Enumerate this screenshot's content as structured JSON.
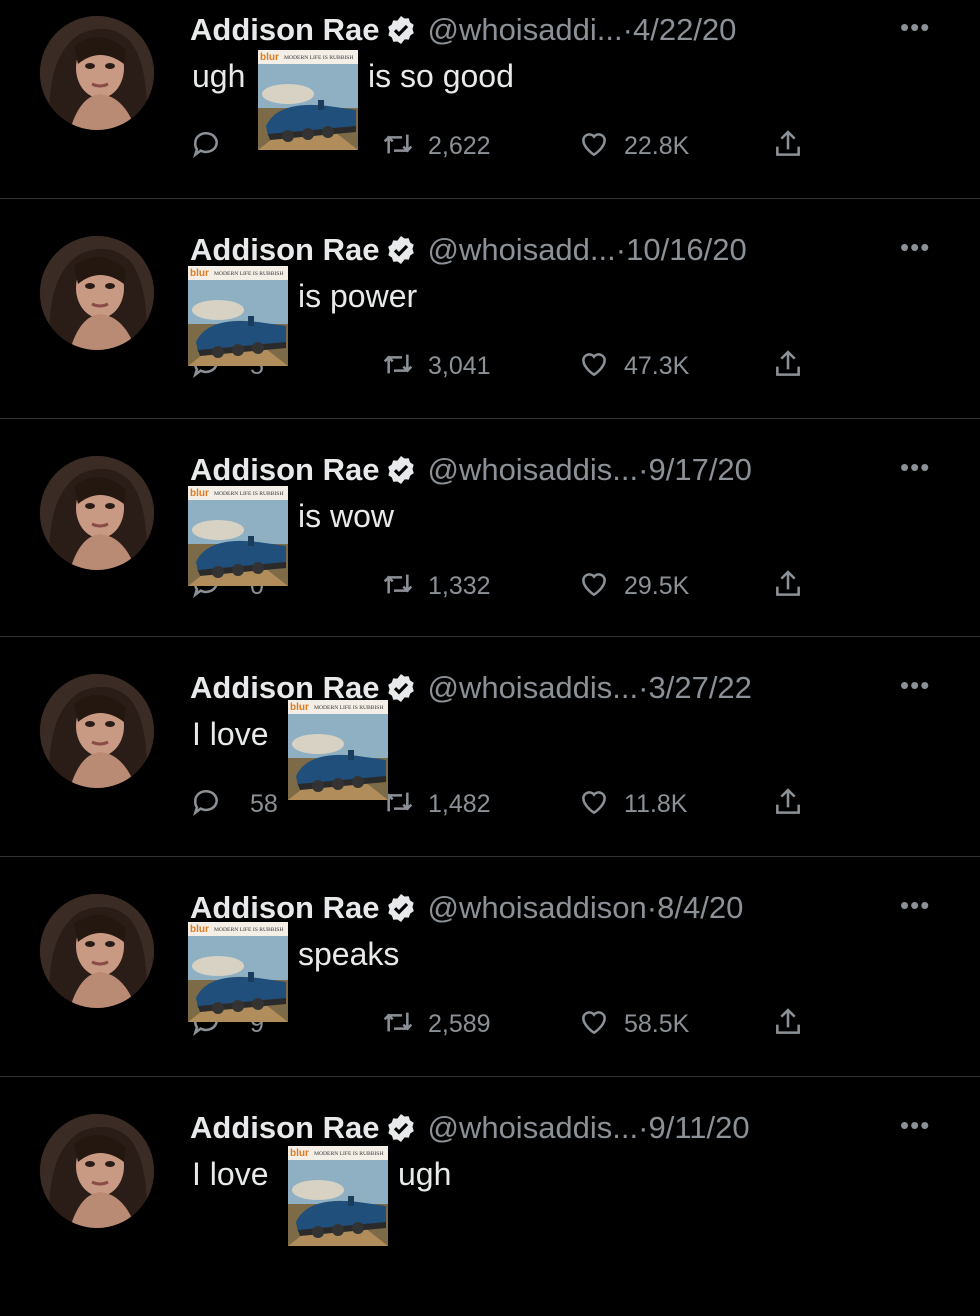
{
  "tweets": [
    {
      "name": "Addison Rae",
      "handle": "@whoisaddi...",
      "dot": "·",
      "date": "4/22/20",
      "before": "ugh",
      "after": "is so good",
      "reply": "",
      "retweets": "2,622",
      "likes": "22.8K",
      "variant": "inline"
    },
    {
      "name": "Addison Rae",
      "handle": "@whoisadd...",
      "dot": "·",
      "date": "10/16/20",
      "before": "",
      "after": "is power",
      "reply": "5",
      "retweets": "3,041",
      "likes": "47.3K",
      "variant": "left"
    },
    {
      "name": "Addison Rae",
      "handle": "@whoisaddis...",
      "dot": "·",
      "date": "9/17/20",
      "before": "",
      "after": "is wow",
      "reply": "0",
      "retweets": "1,332",
      "likes": "29.5K",
      "variant": "left"
    },
    {
      "name": "Addison Rae",
      "handle": "@whoisaddis...",
      "dot": "·",
      "date": "3/27/22",
      "before": "I love",
      "after": "",
      "reply": "58",
      "retweets": "1,482",
      "likes": "11.8K",
      "variant": "inline"
    },
    {
      "name": "Addison Rae",
      "handle": "@whoisaddison",
      "dot": "·",
      "date": "8/4/20",
      "before": "",
      "after": "speaks",
      "reply": "9",
      "retweets": "2,589",
      "likes": "58.5K",
      "variant": "left"
    },
    {
      "name": "Addison Rae",
      "handle": "@whoisaddis...",
      "dot": "·",
      "date": "9/11/20",
      "before": "I love",
      "after": "ugh",
      "reply": "",
      "retweets": "",
      "likes": "",
      "variant": "inline"
    }
  ],
  "album": {
    "band": "blur",
    "title": "MODERN LIFE IS RUBBISH"
  },
  "more_label": "•••",
  "icons": {
    "reply": "reply-icon",
    "retweet": "retweet-icon",
    "like": "heart-icon",
    "share": "share-icon",
    "verified": "verified-badge-icon",
    "more": "more-options-icon"
  },
  "colors": {
    "background": "#000000",
    "text": "#e7e9ea",
    "muted": "#8b9196",
    "divider": "#2f3336"
  }
}
